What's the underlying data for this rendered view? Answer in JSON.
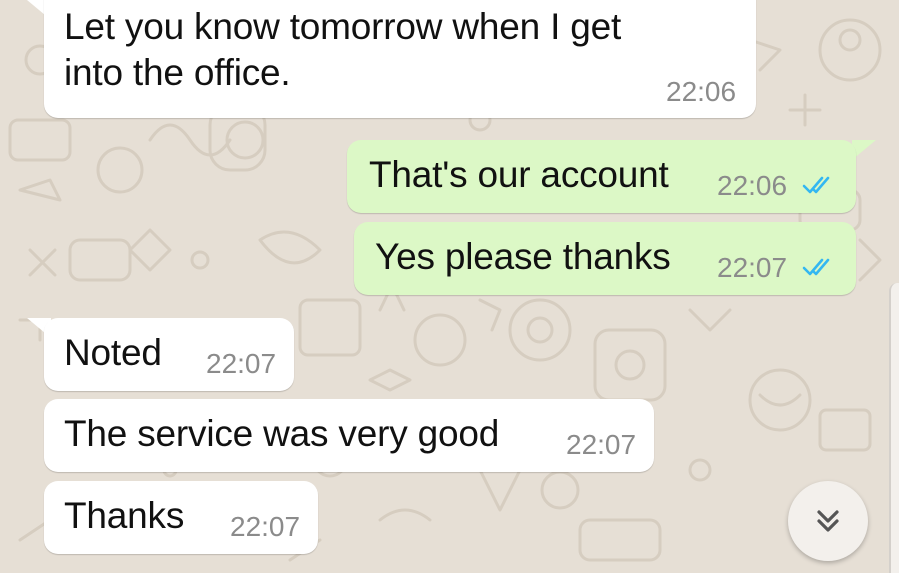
{
  "colors": {
    "background": "#e6dfd5",
    "incoming_bubble": "#ffffff",
    "outgoing_bubble": "#dcf8c6",
    "read_ticks": "#34b7f1",
    "timestamp": "#8b8b8b"
  },
  "messages": [
    {
      "direction": "incoming",
      "lines": [
        "Let you know tomorrow when I get",
        "into the office."
      ],
      "time": "22:06"
    },
    {
      "direction": "outgoing",
      "text": "That's our account",
      "time": "22:06",
      "status": "read"
    },
    {
      "direction": "outgoing",
      "text": "Yes please thanks",
      "time": "22:07",
      "status": "read"
    },
    {
      "direction": "incoming",
      "text": "Noted",
      "time": "22:07"
    },
    {
      "direction": "incoming",
      "text": "The service was very good",
      "time": "22:07"
    },
    {
      "direction": "incoming",
      "text": "Thanks",
      "time": "22:07"
    }
  ],
  "scroll_button": {
    "icon": "double-chevron-down-icon"
  }
}
